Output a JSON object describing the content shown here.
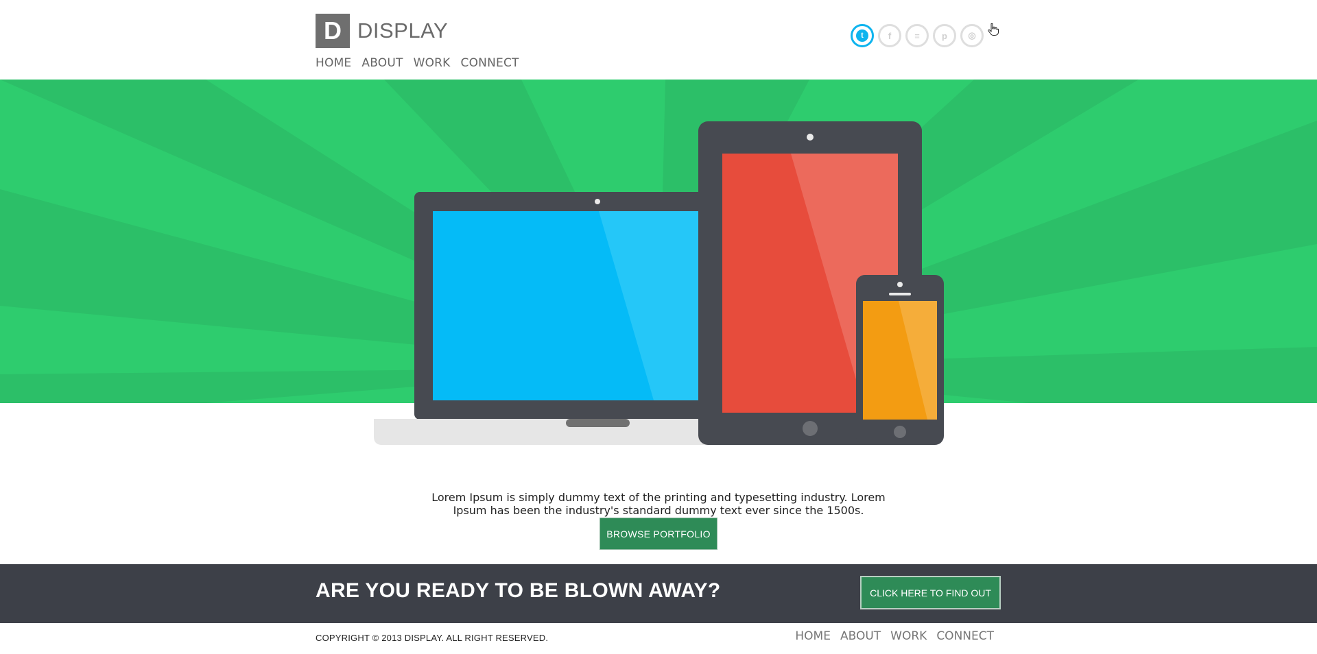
{
  "brand": {
    "logo_letter": "D",
    "name": "DISPLAY"
  },
  "nav": [
    {
      "label": "HOME"
    },
    {
      "label": "ABOUT"
    },
    {
      "label": "WORK"
    },
    {
      "label": "CONNECT"
    }
  ],
  "social": [
    {
      "icon": "twitter-icon",
      "glyph": "t",
      "active": true
    },
    {
      "icon": "facebook-icon",
      "glyph": "f",
      "active": false
    },
    {
      "icon": "rss-icon",
      "glyph": "≡",
      "active": false
    },
    {
      "icon": "pinterest-icon",
      "glyph": "p",
      "active": false
    },
    {
      "icon": "dribbble-icon",
      "glyph": "◎",
      "active": false
    }
  ],
  "hero": {
    "colors": {
      "background": "#2ecc6e",
      "ray": "#2dbf68",
      "device_body": "#474a51",
      "laptop_screen": "#05bbf7",
      "tablet_screen": "#e74c3c",
      "phone_screen": "#f39c12",
      "laptop_base": "#e6e6e6"
    }
  },
  "lead": {
    "text": "Lorem Ipsum is simply dummy text of the printing and typesetting industry. Lorem Ipsum has been the industry's standard dummy text ever since the 1500s."
  },
  "cta": {
    "browse_label": "BROWSE PORTFOLIO"
  },
  "banner": {
    "title": "ARE YOU READY TO BE BLOWN AWAY?",
    "button_label": "CLICK HERE TO FIND OUT",
    "background": "#3d4048"
  },
  "footer": {
    "copyright": "COPYRIGHT © 2013 DISPLAY. ALL RIGHT RESERVED.",
    "nav": [
      {
        "label": "HOME"
      },
      {
        "label": "ABOUT"
      },
      {
        "label": "WORK"
      },
      {
        "label": "CONNECT"
      }
    ]
  },
  "accent": {
    "button_green": "#2e8b57",
    "twitter_blue": "#0fb4ee"
  }
}
